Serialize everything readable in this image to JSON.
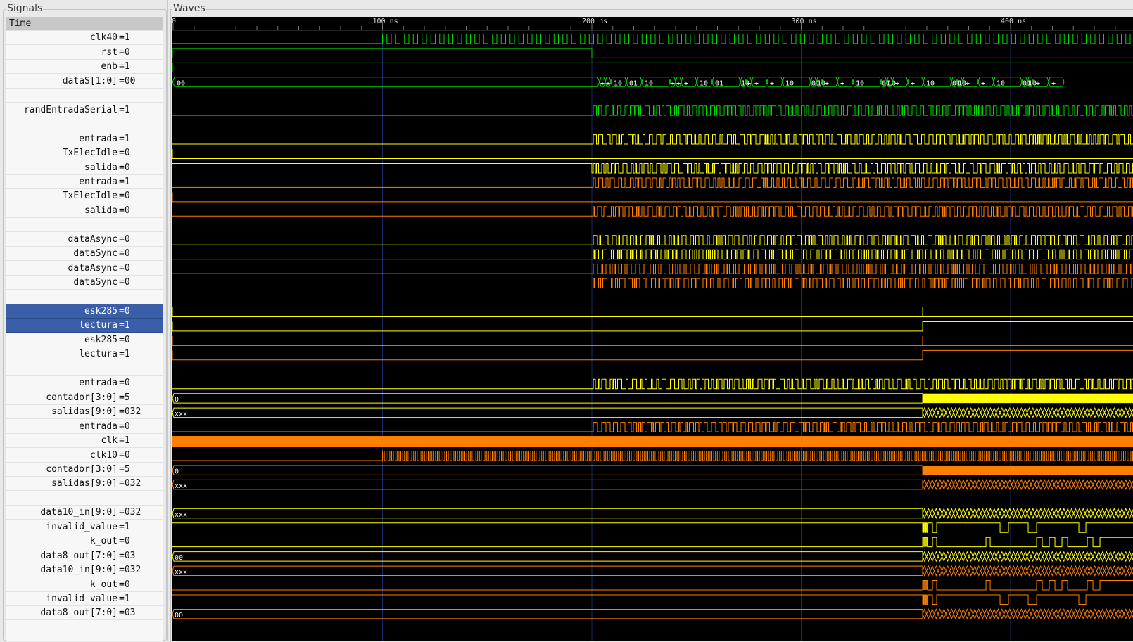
{
  "panels": {
    "signals_title": "Signals",
    "waves_title": "Waves"
  },
  "time_header": "Time",
  "timeline": {
    "start_label": "0",
    "labels": [
      "100 ns",
      "200 ns",
      "300 ns",
      "400 ns"
    ]
  },
  "colors": {
    "green": "#00d800",
    "yellow": "#ffff00",
    "orange": "#ff8000",
    "grid": "#1c2a6a",
    "bg": "#000000",
    "selected": "#3b5ea8"
  },
  "signals": [
    {
      "name": "clk40",
      "value": "=1",
      "color": "green",
      "kind": "clk"
    },
    {
      "name": "rst",
      "value": "=0",
      "color": "green",
      "kind": "rst"
    },
    {
      "name": "enb",
      "value": "=1",
      "color": "green",
      "kind": "enb"
    },
    {
      "name": "dataS[1:0]",
      "value": "=00",
      "color": "green",
      "kind": "dataS",
      "labels": [
        "00",
        "+",
        "+",
        "10",
        "01",
        "10",
        "+",
        "+",
        "+",
        "10",
        "01",
        "10",
        "+",
        "+",
        "+",
        "10",
        "01",
        "10",
        "+",
        "+",
        "10",
        "01",
        "10",
        "+",
        "+",
        "10",
        "01",
        "10",
        "+",
        "+",
        "10",
        "01",
        "10",
        "+",
        "+"
      ]
    },
    {
      "kind": "blank"
    },
    {
      "name": "randEntradaSerial",
      "value": "=1",
      "color": "green",
      "kind": "dense"
    },
    {
      "kind": "blank"
    },
    {
      "name": "entrada",
      "value": "=1",
      "color": "yellow",
      "kind": "dense"
    },
    {
      "name": "TxElecIdle",
      "value": "=0",
      "color": "yellow",
      "kind": "idle"
    },
    {
      "name": "salida",
      "value": "=0",
      "color": "yellow",
      "kind": "dense_hi"
    },
    {
      "name": "entrada",
      "value": "=1",
      "color": "orange",
      "kind": "dense"
    },
    {
      "name": "TxElecIdle",
      "value": "=0",
      "color": "orange",
      "kind": "idle"
    },
    {
      "name": "salida",
      "value": "=0",
      "color": "orange",
      "kind": "dense"
    },
    {
      "kind": "blank"
    },
    {
      "name": "dataAsync",
      "value": "=0",
      "color": "yellow",
      "kind": "dense"
    },
    {
      "name": "dataSync",
      "value": "=0",
      "color": "yellow",
      "kind": "dense"
    },
    {
      "name": "dataAsync",
      "value": "=0",
      "color": "orange",
      "kind": "dense"
    },
    {
      "name": "dataSync",
      "value": "=0",
      "color": "orange",
      "kind": "dense"
    },
    {
      "kind": "blank"
    },
    {
      "name": "esk285",
      "value": "=0",
      "color": "yellow",
      "kind": "spike",
      "selected": true
    },
    {
      "name": "lectura",
      "value": "=1",
      "color": "yellow",
      "kind": "step",
      "selected": true
    },
    {
      "name": "esk285",
      "value": "=0",
      "color": "orange",
      "kind": "spike"
    },
    {
      "name": "lectura",
      "value": "=1",
      "color": "orange",
      "kind": "step"
    },
    {
      "kind": "blank"
    },
    {
      "name": "entrada",
      "value": "=0",
      "color": "yellow",
      "kind": "dense"
    },
    {
      "name": "contador[3:0]",
      "value": "=5",
      "color": "yellow",
      "kind": "bus_fill",
      "label": "0"
    },
    {
      "name": "salidas[9:0]",
      "value": "=032",
      "color": "yellow",
      "kind": "bus_x",
      "label": "xxx"
    },
    {
      "name": "entrada",
      "value": "=0",
      "color": "orange",
      "kind": "dense"
    },
    {
      "name": "clk",
      "value": "=1",
      "color": "orange",
      "kind": "solid"
    },
    {
      "name": "clk10",
      "value": "=0",
      "color": "orange",
      "kind": "clk10"
    },
    {
      "name": "contador[3:0]",
      "value": "=5",
      "color": "orange",
      "kind": "bus_fill",
      "label": "0"
    },
    {
      "name": "salidas[9:0]",
      "value": "=032",
      "color": "orange",
      "kind": "bus_x",
      "label": "xxx"
    },
    {
      "kind": "blank"
    },
    {
      "name": "data10_in[9:0]",
      "value": "=032",
      "color": "yellow",
      "kind": "bus_x",
      "label": "xxx"
    },
    {
      "name": "invalid_value",
      "value": "=1",
      "color": "yellow",
      "kind": "invalid"
    },
    {
      "name": "k_out",
      "value": "=0",
      "color": "yellow",
      "kind": "kout"
    },
    {
      "name": "data8_out[7:0]",
      "value": "=03",
      "color": "yellow",
      "kind": "bus_x",
      "label": "00"
    },
    {
      "name": "data10_in[9:0]",
      "value": "=032",
      "color": "orange",
      "kind": "bus_x",
      "label": "xxx"
    },
    {
      "name": "k_out",
      "value": "=0",
      "color": "orange",
      "kind": "kout"
    },
    {
      "name": "invalid_value",
      "value": "=1",
      "color": "orange",
      "kind": "invalid"
    },
    {
      "name": "data8_out[7:0]",
      "value": "=03",
      "color": "orange",
      "kind": "bus_x",
      "label": "00"
    }
  ]
}
